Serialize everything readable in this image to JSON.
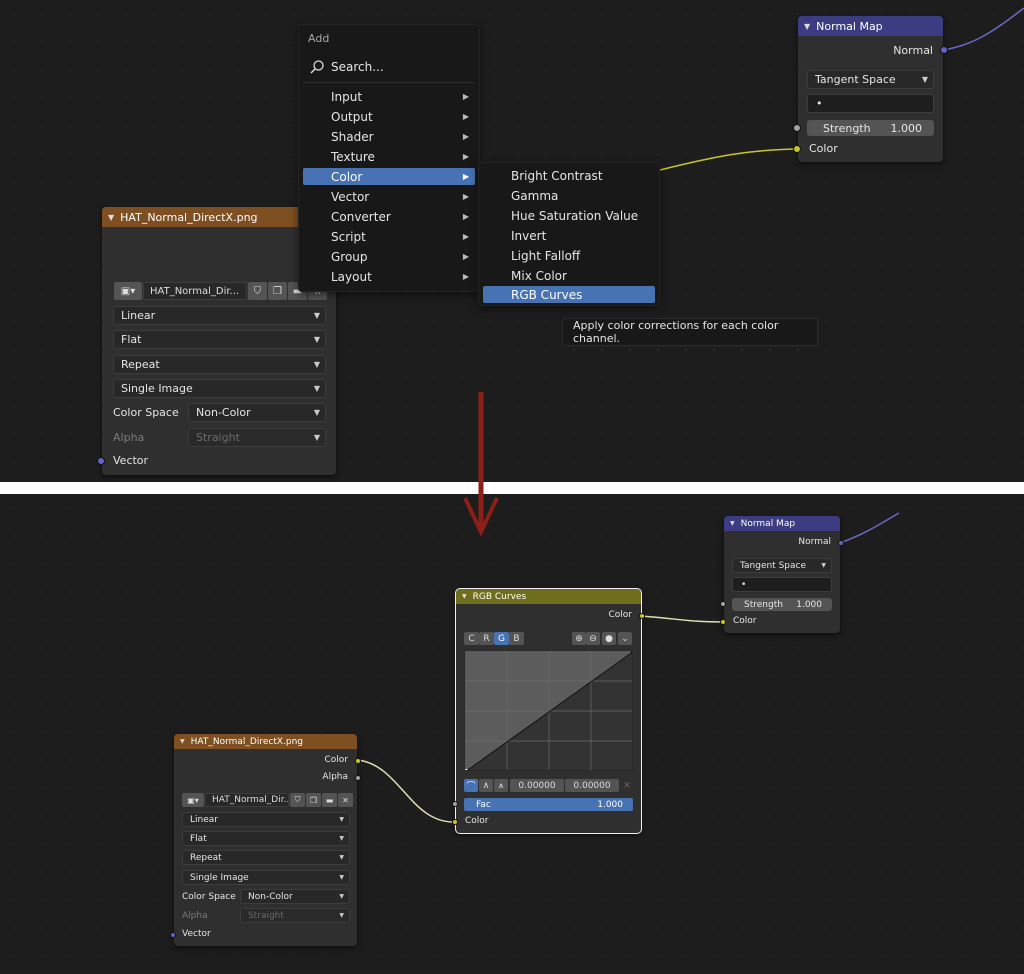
{
  "top": {
    "add_menu": {
      "title": "Add",
      "search_label": "Search...",
      "items": [
        {
          "label": "Input"
        },
        {
          "label": "Output"
        },
        {
          "label": "Shader"
        },
        {
          "label": "Texture"
        },
        {
          "label": "Color"
        },
        {
          "label": "Vector"
        },
        {
          "label": "Converter"
        },
        {
          "label": "Script"
        },
        {
          "label": "Group"
        },
        {
          "label": "Layout"
        }
      ],
      "highlighted": "Color"
    },
    "color_submenu": {
      "items": [
        {
          "label": "Bright Contrast"
        },
        {
          "label": "Gamma"
        },
        {
          "label": "Hue Saturation Value"
        },
        {
          "label": "Invert"
        },
        {
          "label": "Light Falloff"
        },
        {
          "label": "Mix Color"
        },
        {
          "label": "RGB Curves"
        }
      ],
      "highlighted": "RGB Curves"
    },
    "tooltip": "Apply color corrections for each color channel.",
    "normal_map": {
      "title": "Normal Map",
      "output_normal": "Normal",
      "space": "Tangent Space",
      "uv_value": "•",
      "strength_label": "Strength",
      "strength_value": "1.000",
      "input_color": "Color"
    },
    "image_node": {
      "title": "HAT_Normal_DirectX.png",
      "image_name": "HAT_Normal_Dir...",
      "interpolation": "Linear",
      "projection": "Flat",
      "extension": "Repeat",
      "source": "Single Image",
      "color_space_label": "Color Space",
      "color_space": "Non-Color",
      "alpha_label": "Alpha",
      "alpha": "Straight",
      "input_vector": "Vector"
    }
  },
  "bottom": {
    "normal_map": {
      "title": "Normal Map",
      "output_normal": "Normal",
      "space": "Tangent Space",
      "uv_value": "•",
      "strength_label": "Strength",
      "strength_value": "1.000",
      "input_color": "Color"
    },
    "rgb_curves": {
      "title": "RGB Curves",
      "output_color": "Color",
      "channels": [
        "C",
        "R",
        "G",
        "B"
      ],
      "active_channel": "G",
      "x_value": "0.00000",
      "y_value": "0.00000",
      "fac_label": "Fac",
      "fac_value": "1.000",
      "input_color": "Color"
    },
    "image_node": {
      "title": "HAT_Normal_DirectX.png",
      "output_color": "Color",
      "output_alpha": "Alpha",
      "image_name": "HAT_Normal_Dir...",
      "interpolation": "Linear",
      "projection": "Flat",
      "extension": "Repeat",
      "source": "Single Image",
      "color_space_label": "Color Space",
      "color_space": "Non-Color",
      "alpha_label": "Alpha",
      "alpha": "Straight",
      "input_vector": "Vector"
    }
  },
  "colors": {
    "image_header": "#7e4f21",
    "vector_header": "#3c3c83",
    "color_header": "#6e6e1d",
    "highlight": "#4772b3",
    "arrow": "#8b2018"
  }
}
